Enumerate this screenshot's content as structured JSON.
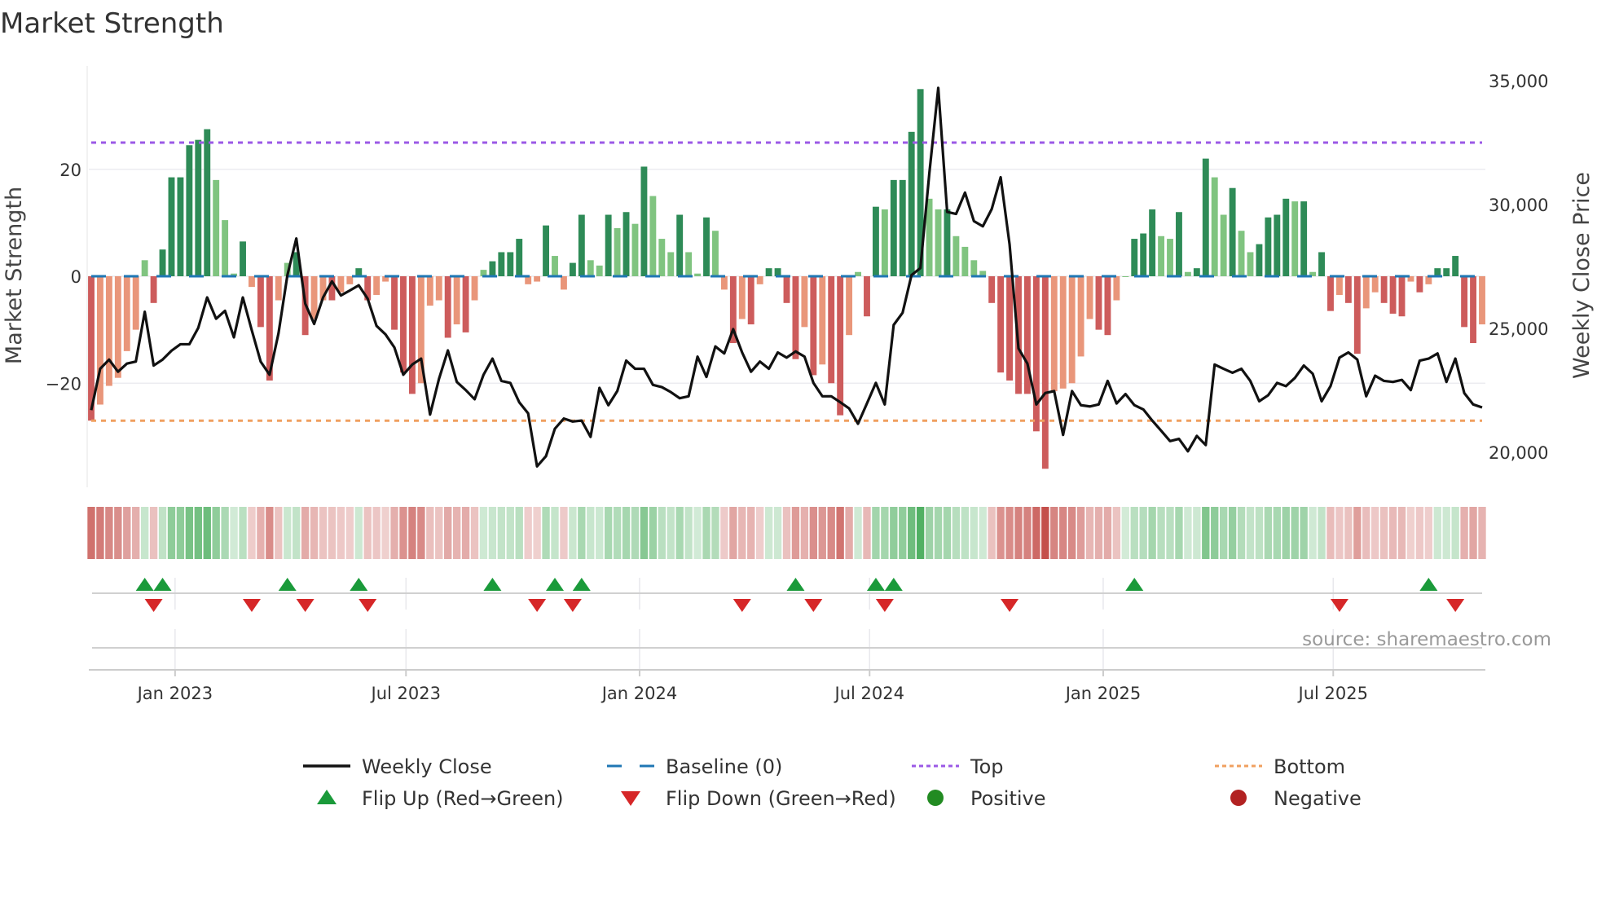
{
  "title": "Market Strength",
  "source": "source: sharemaestro.com",
  "colors": {
    "dark_green": "#2e8b57",
    "light_green": "#80c480",
    "dark_red": "#cd5c5c",
    "light_red": "#e9967a",
    "baseline": "#1f77b4",
    "top": "#9b59e6",
    "bottom": "#f0a060",
    "line": "#111111",
    "flip_up": "#1a9a3a",
    "flip_down": "#d62728",
    "positive": "#228b22",
    "negative": "#b22222"
  },
  "legend": [
    {
      "key": "weekly_close",
      "label": "Weekly Close"
    },
    {
      "key": "baseline",
      "label": "Baseline (0)"
    },
    {
      "key": "top",
      "label": "Top"
    },
    {
      "key": "bottom",
      "label": "Bottom"
    },
    {
      "key": "flip_up",
      "label": "Flip Up (Red→Green)"
    },
    {
      "key": "flip_down",
      "label": "Flip Down (Green→Red)"
    },
    {
      "key": "positive",
      "label": "Positive"
    },
    {
      "key": "negative",
      "label": "Negative"
    }
  ],
  "chart_data": {
    "type": "bar",
    "title": "Market Strength",
    "ylabel": "Market Strength",
    "y2label": "Weekly Close Price",
    "ylim": [
      -40,
      39.5
    ],
    "y2lim": [
      18300,
      35450
    ],
    "yticks": [
      {
        "v": 20,
        "label": "20"
      },
      {
        "v": 0,
        "label": "0"
      },
      {
        "v": -20,
        "label": "−20"
      }
    ],
    "y2ticks": [
      {
        "v": 35000,
        "label": "35,000"
      },
      {
        "v": 30000,
        "label": "30,000"
      },
      {
        "v": 25000,
        "label": "25,000"
      },
      {
        "v": 20000,
        "label": "20,000"
      }
    ],
    "xticks": [
      {
        "at": 9.4,
        "label": "Jan 2023"
      },
      {
        "at": 35.3,
        "label": "Jul 2023"
      },
      {
        "at": 61.5,
        "label": "Jan 2024"
      },
      {
        "at": 87.3,
        "label": "Jul 2024"
      },
      {
        "at": 113.5,
        "label": "Jan 2025"
      },
      {
        "at": 139.3,
        "label": "Jul 2025"
      }
    ],
    "x_unit": "week index",
    "top_level": 25,
    "bottom_level": -27,
    "baseline": 0,
    "strength": [
      -27,
      -24,
      -20.5,
      -19,
      -14,
      -10,
      3,
      -5,
      5,
      18.5,
      18.5,
      24.5,
      25.5,
      27.5,
      18,
      10.5,
      0.5,
      6.5,
      -2,
      -9.5,
      -19.5,
      -4.5,
      2.5,
      4.5,
      -11,
      -8,
      -4.5,
      -4.5,
      -3,
      -1.5,
      1.5,
      -4.5,
      -3.5,
      -1,
      -10,
      -18,
      -22,
      -20,
      -5.5,
      -4.5,
      -11.5,
      -9,
      -10.5,
      -4.5,
      1.2,
      2.8,
      4.5,
      4.5,
      7,
      -1.5,
      -1,
      9.5,
      3.8,
      -2.5,
      2.5,
      11.5,
      3,
      2,
      11.5,
      9,
      12,
      9.8,
      20.5,
      15,
      7,
      4.5,
      11.5,
      4.5,
      0.5,
      11,
      8.5,
      -2.5,
      -12.5,
      -8,
      -9,
      -1.5,
      1.5,
      1.5,
      -5,
      -15.5,
      -9.5,
      -18.5,
      -16.5,
      -20,
      -26,
      -11,
      0.8,
      -7.5,
      13,
      12.5,
      18,
      18,
      27,
      35,
      14.5,
      12.5,
      12.5,
      7.5,
      5.5,
      3,
      1,
      -5,
      -18,
      -19.5,
      -22,
      -22,
      -29,
      -36,
      -21.5,
      -21,
      -20,
      -15,
      -8,
      -10,
      -11,
      -4.5,
      0,
      7,
      8,
      12.5,
      7.5,
      7,
      12,
      0.8,
      1.5,
      22,
      18.5,
      11.5,
      16.5,
      8.5,
      4.5,
      6,
      11,
      11.5,
      14.5,
      14,
      14,
      0.8,
      4.5,
      -6.5,
      -3.5,
      -5,
      -14.5,
      -6,
      -3,
      -5,
      -7,
      -7.5,
      -1,
      -3,
      -1.5,
      1.5,
      1.5,
      3.8,
      -9.5,
      -12.5,
      -9
    ],
    "close": [
      21700,
      23370,
      23740,
      23250,
      23580,
      23660,
      25670,
      23500,
      23740,
      24100,
      24360,
      24360,
      25020,
      26250,
      25390,
      25710,
      24640,
      26250,
      24930,
      23660,
      23130,
      24800,
      27150,
      28630,
      26000,
      25180,
      26250,
      26900,
      26330,
      26530,
      26740,
      26200,
      25100,
      24760,
      24230,
      23130,
      23540,
      23780,
      21520,
      22960,
      24110,
      22840,
      22510,
      22140,
      23130,
      23780,
      22880,
      22800,
      22020,
      21570,
      19430,
      19840,
      20950,
      21360,
      21240,
      21280,
      20620,
      22600,
      21900,
      22470,
      23700,
      23370,
      23370,
      22720,
      22630,
      22430,
      22180,
      22260,
      23860,
      23040,
      24270,
      23990,
      24970,
      24030,
      23250,
      23660,
      23370,
      24030,
      23820,
      24070,
      23860,
      22800,
      22260,
      22260,
      22020,
      21770,
      21150,
      21970,
      22800,
      21930,
      25140,
      25630,
      27150,
      27440,
      31260,
      34710,
      29700,
      29620,
      30480,
      29330,
      29120,
      29820,
      31100,
      28390,
      24190,
      23580,
      21930,
      22390,
      22470,
      20700,
      22470,
      21900,
      21850,
      21930,
      22880,
      21970,
      22350,
      21900,
      21730,
      21280,
      20870,
      20450,
      20540,
      20040,
      20660,
      20290,
      23540,
      23370,
      23210,
      23370,
      22880,
      22060,
      22300,
      22800,
      22670,
      23000,
      23500,
      23170,
      22060,
      22670,
      23820,
      24030,
      23740,
      22260,
      23090,
      22880,
      22840,
      22920,
      22510,
      23700,
      23780,
      23990,
      22840,
      23780,
      22390,
      21930,
      21810
    ],
    "flip_up": [
      6,
      8,
      22,
      30,
      45,
      52,
      55,
      79,
      88,
      90,
      117,
      150
    ],
    "flip_down": [
      7,
      18,
      24,
      31,
      50,
      54,
      73,
      81,
      89,
      103,
      140,
      153
    ]
  }
}
